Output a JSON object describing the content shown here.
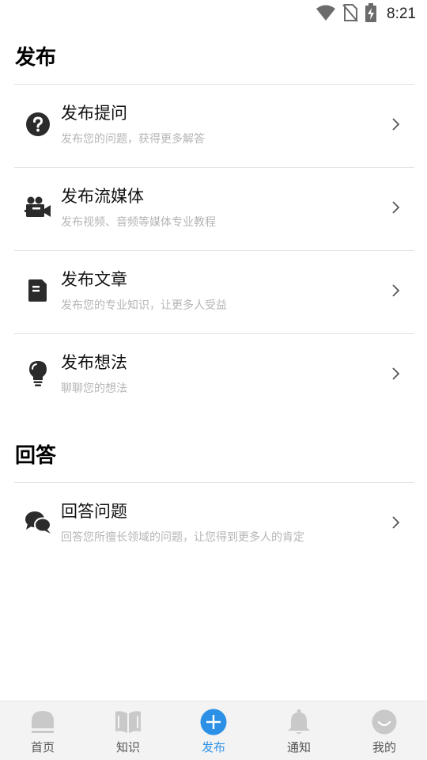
{
  "status_bar": {
    "time": "8:21"
  },
  "sections": {
    "publish": {
      "title": "发布",
      "items": [
        {
          "title": "发布提问",
          "subtitle": "发布您的问题，获得更多解答",
          "icon": "question-circle-icon"
        },
        {
          "title": "发布流媒体",
          "subtitle": "发布视频、音频等媒体专业教程",
          "icon": "video-camera-icon"
        },
        {
          "title": "发布文章",
          "subtitle": "发布您的专业知识，让更多人受益",
          "icon": "article-icon"
        },
        {
          "title": "发布想法",
          "subtitle": "聊聊您的想法",
          "icon": "lightbulb-icon"
        }
      ]
    },
    "answer": {
      "title": "回答",
      "items": [
        {
          "title": "回答问题",
          "subtitle": "回答您所擅长领域的问题，让您得到更多人的肯定",
          "icon": "chat-bubbles-icon"
        }
      ]
    }
  },
  "tabbar": {
    "tabs": [
      {
        "label": "首页",
        "icon": "home-icon",
        "active": false
      },
      {
        "label": "知识",
        "icon": "book-icon",
        "active": false
      },
      {
        "label": "发布",
        "icon": "plus-circle-icon",
        "active": true
      },
      {
        "label": "通知",
        "icon": "bell-icon",
        "active": false
      },
      {
        "label": "我的",
        "icon": "smile-face-icon",
        "active": false
      }
    ]
  },
  "colors": {
    "accent": "#2c91e6",
    "icon_dark": "#2b2b2b",
    "subtitle": "#b5b5b5",
    "tab_inactive": "#c9c9c9"
  }
}
